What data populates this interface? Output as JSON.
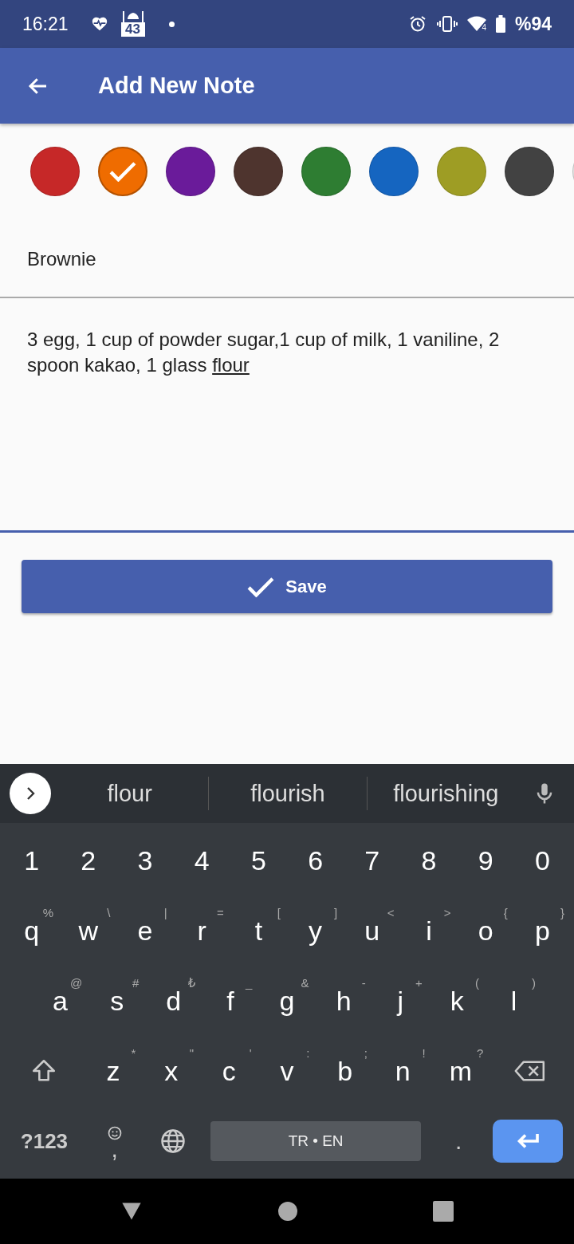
{
  "status_bar": {
    "time": "16:21",
    "notification_badge": "43",
    "wifi_badge": "4",
    "battery": "%94"
  },
  "app_bar": {
    "title": "Add New Note"
  },
  "colors": [
    {
      "color": "#c62828",
      "selected": false
    },
    {
      "color": "#ef6c00",
      "selected": true
    },
    {
      "color": "#6a1b9a",
      "selected": false
    },
    {
      "color": "#4e342e",
      "selected": false
    },
    {
      "color": "#2e7d32",
      "selected": false
    },
    {
      "color": "#1565c0",
      "selected": false
    },
    {
      "color": "#9e9d24",
      "selected": false
    },
    {
      "color": "#424242",
      "selected": false
    },
    {
      "color": "#e0e0e0",
      "selected": false
    }
  ],
  "title_field": {
    "value": "Brownie"
  },
  "body_field": {
    "value": "3 egg, 1 cup of powder sugar,1 cup of milk, 1 vaniline, 2 spoon kakao, 1 glass ",
    "composing": "flour",
    "focused": true
  },
  "save_button": {
    "label": "Save"
  },
  "keyboard": {
    "suggestions": [
      "flour",
      "flourish",
      "flourishing"
    ],
    "rows": [
      [
        {
          "label": "1"
        },
        {
          "label": "2"
        },
        {
          "label": "3"
        },
        {
          "label": "4"
        },
        {
          "label": "5"
        },
        {
          "label": "6"
        },
        {
          "label": "7"
        },
        {
          "label": "8"
        },
        {
          "label": "9"
        },
        {
          "label": "0"
        }
      ],
      [
        {
          "label": "q",
          "hint": "%"
        },
        {
          "label": "w",
          "hint": "\\"
        },
        {
          "label": "e",
          "hint": "|"
        },
        {
          "label": "r",
          "hint": "="
        },
        {
          "label": "t",
          "hint": "["
        },
        {
          "label": "y",
          "hint": "]"
        },
        {
          "label": "u",
          "hint": "<"
        },
        {
          "label": "i",
          "hint": ">"
        },
        {
          "label": "o",
          "hint": "{"
        },
        {
          "label": "p",
          "hint": "}"
        }
      ],
      [
        {
          "label": "a",
          "hint": "@"
        },
        {
          "label": "s",
          "hint": "#"
        },
        {
          "label": "d",
          "hint": "₺"
        },
        {
          "label": "f",
          "hint": "_"
        },
        {
          "label": "g",
          "hint": "&"
        },
        {
          "label": "h",
          "hint": "-"
        },
        {
          "label": "j",
          "hint": "+"
        },
        {
          "label": "k",
          "hint": "("
        },
        {
          "label": "l",
          "hint": ")"
        }
      ],
      [
        {
          "kind": "shift"
        },
        {
          "label": "z",
          "hint": "*"
        },
        {
          "label": "x",
          "hint": "\""
        },
        {
          "label": "c",
          "hint": "'"
        },
        {
          "label": "v",
          "hint": ":"
        },
        {
          "label": "b",
          "hint": ";"
        },
        {
          "label": "n",
          "hint": "!"
        },
        {
          "label": "m",
          "hint": "?"
        },
        {
          "kind": "backspace"
        }
      ],
      [
        {
          "kind": "symbols",
          "label": "?123"
        },
        {
          "kind": "comma",
          "label": ","
        },
        {
          "kind": "globe"
        },
        {
          "kind": "space",
          "label": "TR • EN"
        },
        {
          "kind": "period",
          "label": "."
        },
        {
          "kind": "enter"
        }
      ]
    ]
  }
}
